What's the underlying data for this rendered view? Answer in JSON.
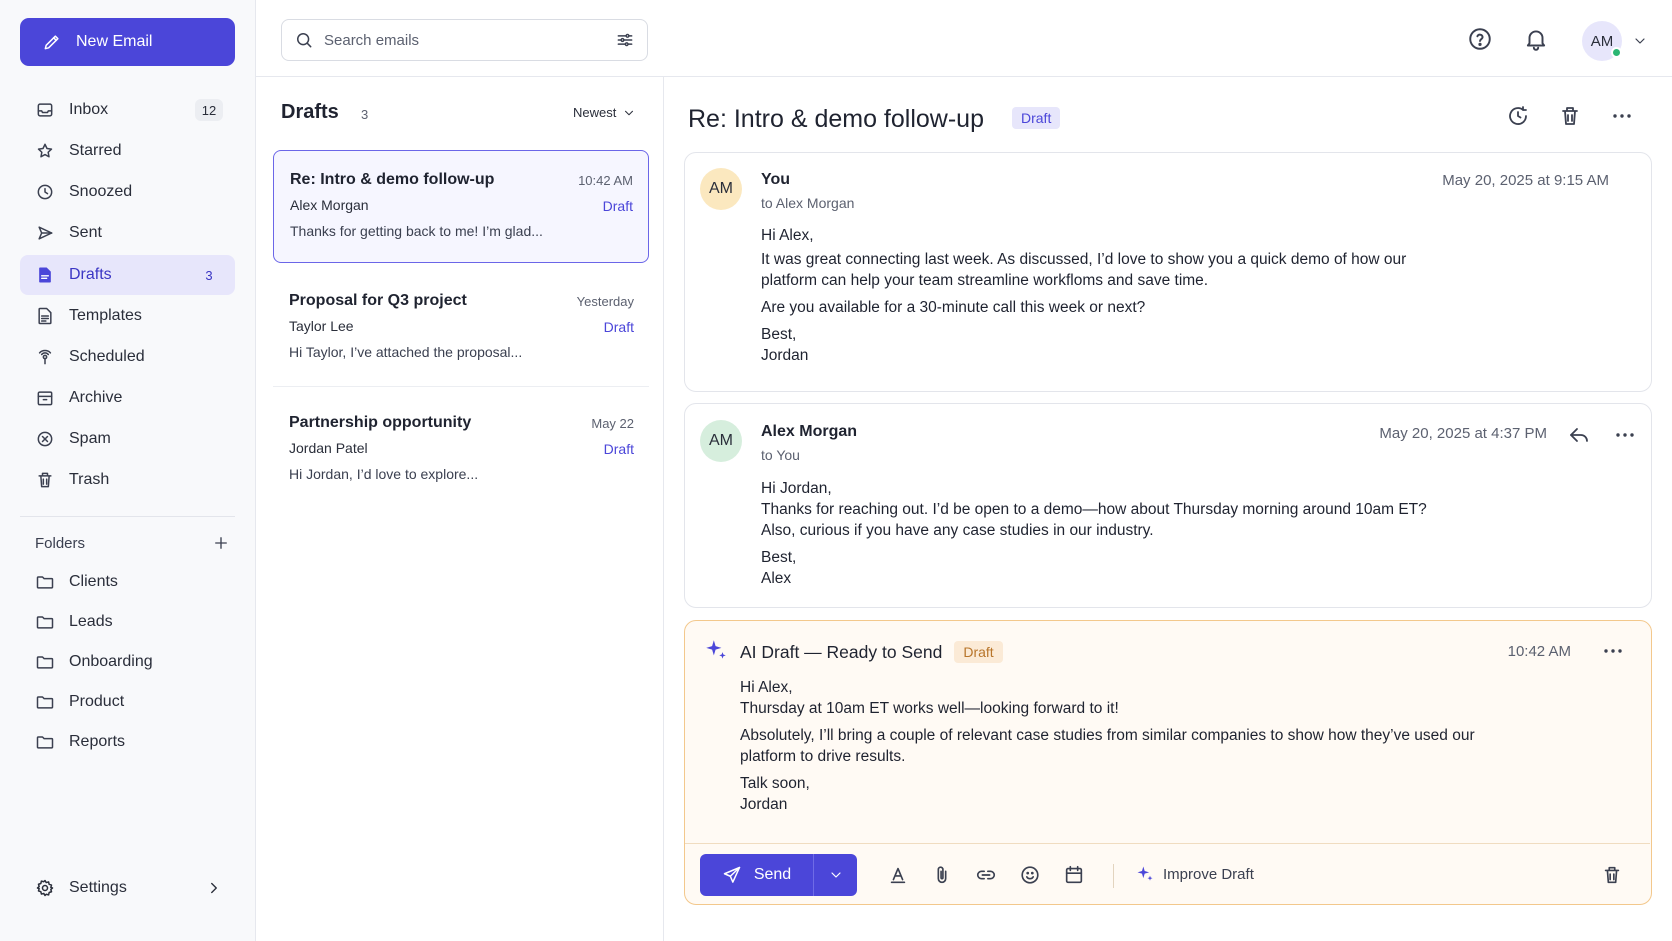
{
  "colors": {
    "accent": "#4b46d9",
    "draft_orange": "#f3c88c",
    "online": "#2bb673"
  },
  "sidebar": {
    "new_email_label": "New Email",
    "items": [
      {
        "label": "Inbox",
        "count": "12",
        "icon": "inbox-icon"
      },
      {
        "label": "Starred",
        "count": "",
        "icon": "star-icon"
      },
      {
        "label": "Snoozed",
        "count": "",
        "icon": "clock-icon"
      },
      {
        "label": "Sent",
        "count": "",
        "icon": "send-icon"
      },
      {
        "label": "Drafts",
        "count": "3",
        "icon": "draft-file-icon"
      },
      {
        "label": "Templates",
        "count": "",
        "icon": "template-icon"
      },
      {
        "label": "Scheduled",
        "count": "",
        "icon": "scheduled-icon"
      },
      {
        "label": "Archive",
        "count": "",
        "icon": "archive-icon"
      },
      {
        "label": "Spam",
        "count": "",
        "icon": "spam-icon"
      },
      {
        "label": "Trash",
        "count": "",
        "icon": "trash-icon"
      }
    ],
    "folders_label": "Folders",
    "folders": [
      "Clients",
      "Leads",
      "Onboarding",
      "Product",
      "Reports"
    ],
    "settings_label": "Settings"
  },
  "topbar": {
    "search_placeholder": "Search emails",
    "avatar_initials": "AM"
  },
  "list": {
    "title": "Drafts",
    "count": "3",
    "sort_label": "Newest",
    "items": [
      {
        "subject": "Re: Intro & demo follow-up",
        "time": "10:42 AM",
        "from": "Alex Morgan",
        "tag": "Draft",
        "snippet": "Thanks for getting back to me! I’m glad..."
      },
      {
        "subject": "Proposal for Q3 project",
        "time": "Yesterday",
        "from": "Taylor Lee",
        "tag": "Draft",
        "snippet": "Hi Taylor, I’ve attached the proposal..."
      },
      {
        "subject": "Partnership opportunity",
        "time": "May 22",
        "from": "Jordan Patel",
        "tag": "Draft",
        "snippet": "Hi Jordan, I’d love to explore..."
      }
    ]
  },
  "thread": {
    "subject": "Re: Intro & demo follow-up",
    "badge": "Draft",
    "messages": [
      {
        "initials": "AM",
        "from": "You",
        "to": "to Alex Morgan",
        "date": "May 20, 2025 at 9:15 AM",
        "body": [
          "Hi Alex,",
          "It was great connecting last week. As discussed, I’d love to show you a quick demo of how our platform can help your team streamline workfloms and save time.",
          "Are you available for a 30-minute call this week or next?",
          "Best,",
          "Jordan"
        ]
      },
      {
        "initials": "AM",
        "from": "Alex Morgan",
        "to": "to You",
        "date": "May 20, 2025 at 4:37 PM",
        "body": [
          "Hi Jordan,",
          "Thanks for reaching out. I’d be open to a demo—how about Thursday morning around 10am ET?",
          "Also, curious if you have any case studies in our industry.",
          "Best,",
          "Alex"
        ]
      }
    ],
    "ai_draft": {
      "title": "AI Draft — Ready to Send",
      "badge": "Draft",
      "time": "10:42 AM",
      "body": [
        "Hi Alex,",
        "Thursday at 10am ET works well—looking forward to it!",
        "Absolutely, I’ll bring a couple of relevant case studies from similar companies to show how they’ve used our platform to drive results.",
        "Talk soon,",
        "Jordan"
      ],
      "send_label": "Send",
      "improve_label": "Improve Draft"
    }
  }
}
